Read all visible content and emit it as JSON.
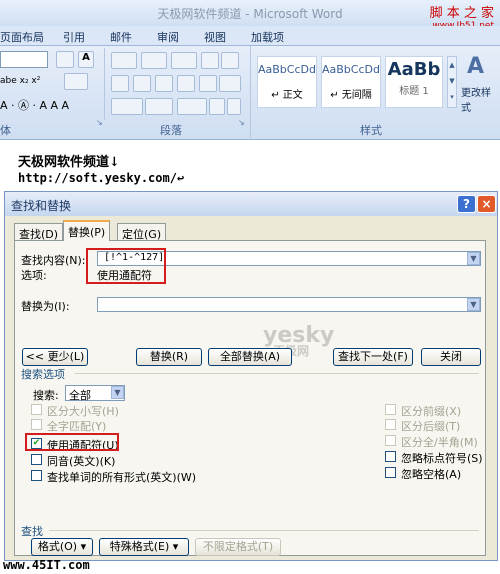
{
  "window": {
    "title": "天极网软件频道 - Microsoft Word"
  },
  "watermark_top": {
    "line1": "脚 本 之 家",
    "line2": "www.Jb51.net"
  },
  "ribbon": {
    "tabs": [
      "页面布局",
      "引用",
      "邮件",
      "审阅",
      "视图",
      "加载项"
    ],
    "groups": {
      "font": "体",
      "paragraph": "段落",
      "styles": "样式"
    },
    "styles": [
      {
        "sample": "AaBbCcDd",
        "name": "↵ 正文"
      },
      {
        "sample": "AaBbCcDd",
        "name": "↵ 无间隔"
      },
      {
        "sample": "AaBb",
        "name": "标题 1"
      }
    ],
    "change_styles": "更改样式"
  },
  "document": {
    "line1": "天极网软件频道↓",
    "line2": "http://soft.yesky.com/↩"
  },
  "dialog": {
    "title": "查找和替换",
    "help": "?",
    "close": "×",
    "tabs": [
      "查找(D)",
      "替换(P)",
      "定位(G)"
    ],
    "find_label": "查找内容(N):",
    "find_value": "[!^1-^127]",
    "options_label": "选项:",
    "options_value": "使用通配符",
    "replace_label": "替换为(I):",
    "replace_value": "",
    "buttons": {
      "less": "<< 更少(L)",
      "replace": "替换(R)",
      "replace_all": "全部替换(A)",
      "find_next": "查找下一处(F)",
      "close": "关闭"
    },
    "search_options_title": "搜索选项",
    "search_label": "搜索:",
    "search_value": "全部",
    "options_left": [
      {
        "label": "区分大小写(H)",
        "checked": false,
        "disabled": true
      },
      {
        "label": "全字匹配(Y)",
        "checked": false,
        "disabled": true
      },
      {
        "label": "使用通配符(U)",
        "checked": true,
        "disabled": false
      },
      {
        "label": "同音(英文)(K)",
        "checked": false,
        "disabled": false
      },
      {
        "label": "查找单词的所有形式(英文)(W)",
        "checked": false,
        "disabled": false
      }
    ],
    "options_right": [
      {
        "label": "区分前缀(X)",
        "checked": false,
        "disabled": true
      },
      {
        "label": "区分后缀(T)",
        "checked": false,
        "disabled": true
      },
      {
        "label": "区分全/半角(M)",
        "checked": false,
        "disabled": true
      },
      {
        "label": "忽略标点符号(S)",
        "checked": false,
        "disabled": false
      },
      {
        "label": "忽略空格(A)",
        "checked": false,
        "disabled": false
      }
    ],
    "find_section_title": "查找",
    "bottom_buttons": {
      "format": "格式(O) ▾",
      "special": "特殊格式(E) ▾",
      "no_format": "不限定格式(T)"
    },
    "watermark": {
      "line1": "yesky",
      "line2": "天极网"
    }
  },
  "watermark_bottom": "www.45IT.com"
}
